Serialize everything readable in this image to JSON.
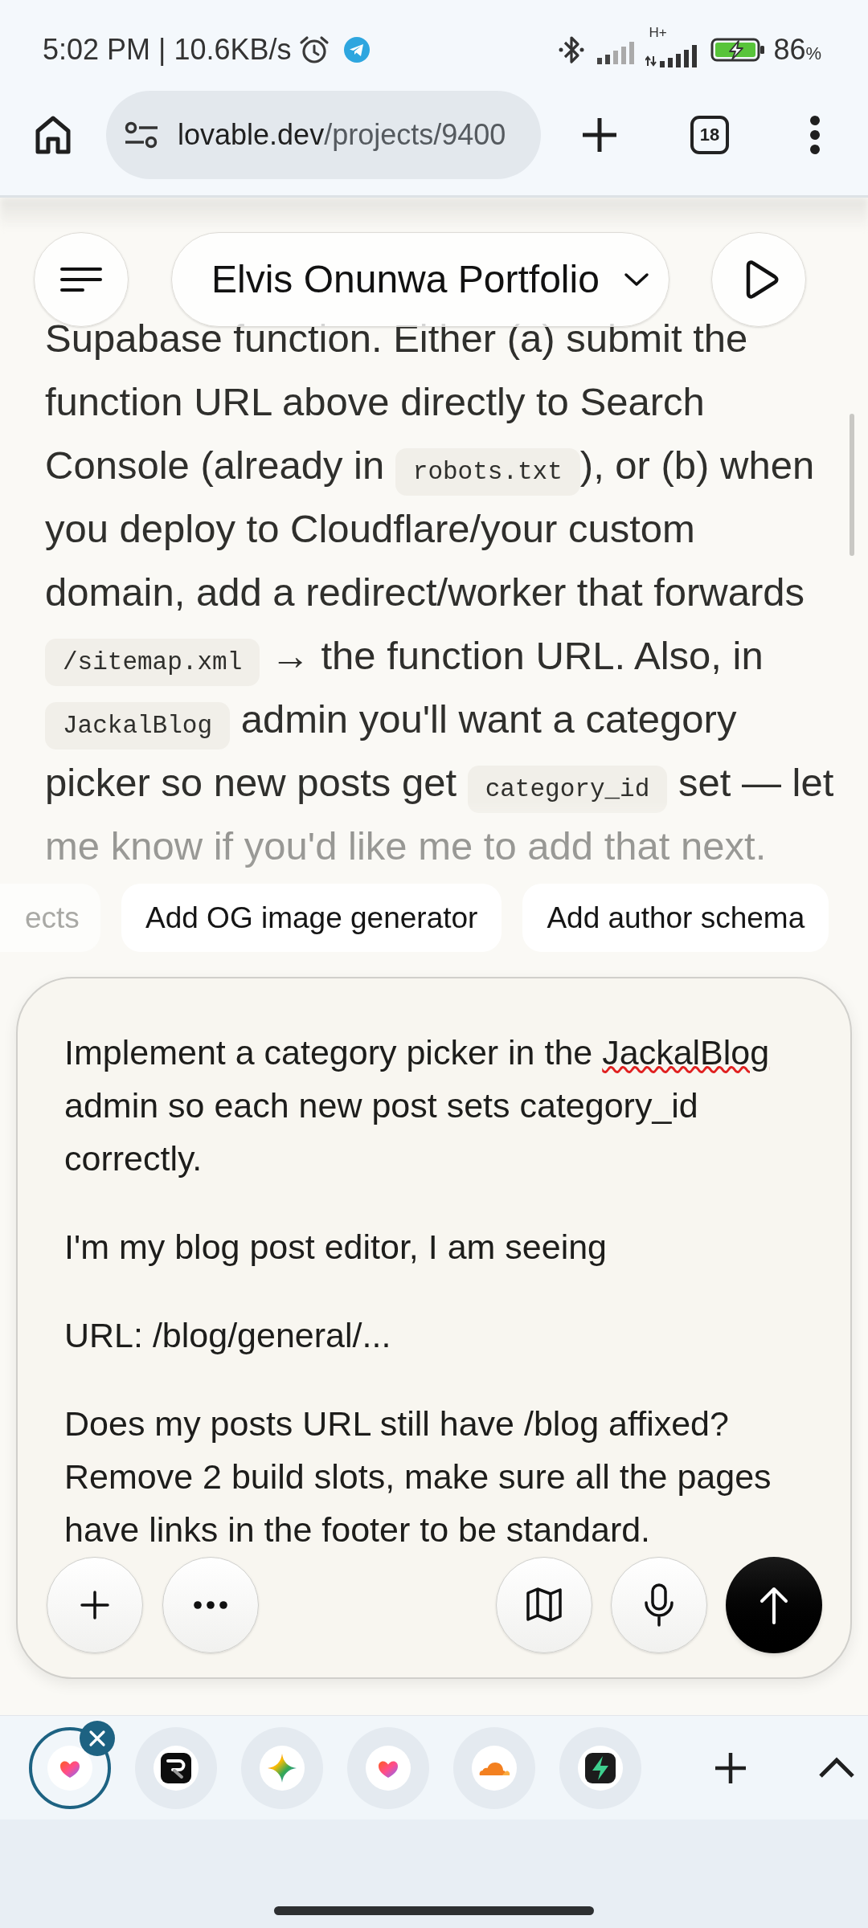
{
  "status_bar": {
    "time_and_speed": "5:02 PM | 10.6KB/s",
    "network_type": "H+",
    "battery_percent": "86",
    "percent_sign": "%"
  },
  "browser": {
    "url_host": "lovable.dev",
    "url_path": "/projects/9400",
    "tab_count": "18"
  },
  "project_header": {
    "title": "Elvis Onunwa Portfolio"
  },
  "message": {
    "segments": [
      {
        "kind": "text",
        "text": "Supabase function. Either (a) submit the function URL above directly to Search Console (already in "
      },
      {
        "kind": "code",
        "text": "robots.txt"
      },
      {
        "kind": "text",
        "text": "), or (b) when you deploy to Cloudflare/your custom domain, add a redirect/worker that forwards "
      },
      {
        "kind": "code",
        "text": "/sitemap.xml"
      },
      {
        "kind": "text",
        "text": " → the function URL. Also, in "
      },
      {
        "kind": "code",
        "text": "JackalBlog"
      },
      {
        "kind": "text",
        "text": " admin you'll want a category picker so new posts get "
      },
      {
        "kind": "code",
        "text": "category_id"
      },
      {
        "kind": "text",
        "text": " set — let me know if you'd like me to add that next."
      }
    ]
  },
  "suggestions": [
    {
      "kind": "clipped",
      "label": "ects"
    },
    {
      "kind": "chip",
      "label": "Add OG image generator"
    },
    {
      "kind": "chip",
      "label": "Add author schema"
    }
  ],
  "composer": {
    "paragraphs": [
      {
        "segments": [
          {
            "text": "Implement a category picker in the ",
            "misspelled": false
          },
          {
            "text": "JackalBlog",
            "misspelled": true
          },
          {
            "text": " admin so each new post sets category_id correctly.",
            "misspelled": false
          }
        ]
      },
      {
        "segments": [
          {
            "text": "I'm my blog post editor, I am seeing",
            "misspelled": false
          }
        ]
      },
      {
        "segments": [
          {
            "text": "URL: /blog/general/...",
            "misspelled": false
          }
        ]
      },
      {
        "segments": [
          {
            "text": "Does my posts URL still have /blog affixed? Remove 2 build slots, make sure all the pages have links in the footer to be standard.",
            "misspelled": false
          }
        ]
      }
    ]
  },
  "tab_strip": {
    "tabs": [
      {
        "kind": "heart",
        "selected": true
      },
      {
        "kind": "tile",
        "selected": false
      },
      {
        "kind": "sparkle",
        "selected": false
      },
      {
        "kind": "heart",
        "selected": false
      },
      {
        "kind": "cloud",
        "selected": false
      },
      {
        "kind": "bolt",
        "selected": false
      }
    ]
  }
}
